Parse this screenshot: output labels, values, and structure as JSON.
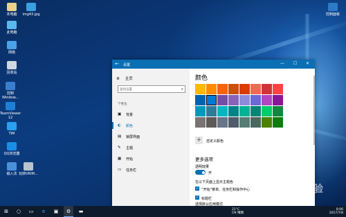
{
  "desktop": {
    "icons": [
      {
        "label": "本电脑",
        "color": "#e8d28a"
      },
      {
        "label": "img43.jpg",
        "color": "#3aa0e0"
      },
      {
        "label": "此电脑",
        "color": "#5cb6f0"
      },
      {
        "label": "网络",
        "color": "#4aa2e8"
      },
      {
        "label": "回收站",
        "color": "#cfd8e0"
      },
      {
        "label": "控制\nWindow...",
        "color": "#3a7ed0"
      },
      {
        "label": "TeamViewer\n12",
        "color": "#1e7fd8"
      },
      {
        "label": "TIM",
        "color": "#2aa0f0"
      },
      {
        "label": "QQ浏览器",
        "color": "#1b8fe6"
      },
      {
        "label": "输入法",
        "color": "#4a90d9"
      },
      {
        "label": "玩转VRIM...",
        "color": "#b8c4d0"
      },
      {
        "label": "控制面板",
        "color": "#2f7ac8"
      }
    ]
  },
  "window": {
    "title": "设置",
    "back_icon": "←",
    "minimize": "—",
    "maximize": "☐",
    "close": "✕"
  },
  "sidebar": {
    "home": "主页",
    "search_placeholder": "查找设置",
    "section": "个性化",
    "items": [
      {
        "label": "背景",
        "icon": "▣",
        "active": false
      },
      {
        "label": "颜色",
        "icon": "◐",
        "active": true
      },
      {
        "label": "锁屏界面",
        "icon": "▤",
        "active": false
      },
      {
        "label": "主题",
        "icon": "✎",
        "active": false
      },
      {
        "label": "开始",
        "icon": "▦",
        "active": false
      },
      {
        "label": "任务栏",
        "icon": "▭",
        "active": false
      }
    ]
  },
  "content": {
    "heading": "颜色",
    "swatches": [
      "#ffb900",
      "#ff8c00",
      "#f7630c",
      "#ca5010",
      "#da3b01",
      "#ef6950",
      "#d13438",
      "#ff4343",
      "#0063b1",
      "#0078d7",
      "#744da9",
      "#8764b8",
      "#8e8cd8",
      "#6b69d6",
      "#b146c2",
      "#881798",
      "#0099bc",
      "#2d7d9a",
      "#00b7c3",
      "#038387",
      "#00b294",
      "#018574",
      "#00cc6a",
      "#10893e",
      "#7a7574",
      "#5d5a58",
      "#68768a",
      "#515c6b",
      "#567c73",
      "#486860",
      "#498205",
      "#107c10"
    ],
    "selected_index": 9,
    "custom_color": "自定义颜色",
    "more_options": "更多选项",
    "transparency_label": "透明效果",
    "transparency_state": "开",
    "show_accent_label": "在以下页面上显示主题色",
    "check1": "“开始”菜单、任务栏和操作中心",
    "check2": "标题栏",
    "choose_mode": "选择默认应用模式"
  },
  "taskbar": {
    "start_icon": "⊞",
    "items": [
      "○",
      "▭",
      "e",
      "▣",
      "⚙",
      "▬"
    ],
    "weather": "21°C",
    "weather_sub": "CN 晴朗",
    "time": "8:06",
    "date": "2017/7/8"
  },
  "watermark": "Bai经验"
}
